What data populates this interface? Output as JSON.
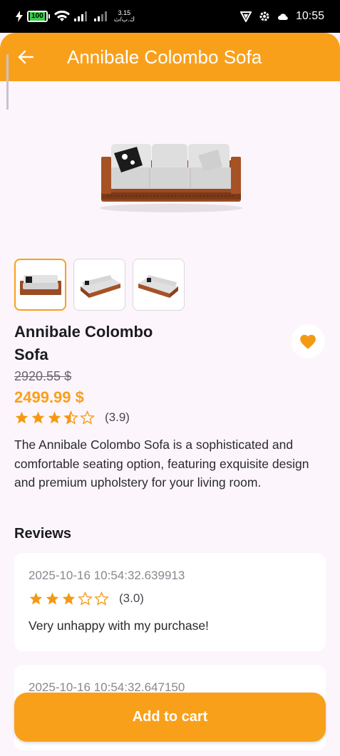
{
  "status_bar": {
    "battery": "100",
    "net_speed_top": "3.15",
    "net_speed_bottom": "ك.ب/ث",
    "time": "10:55"
  },
  "app_bar": {
    "title": "Annibale Colombo Sofa",
    "back_icon": "arrow-left-icon"
  },
  "product": {
    "name": "Annibale Colombo Sofa",
    "old_price": "2920.55 $",
    "price": "2499.99 $",
    "rating": 3.9,
    "rating_label": "(3.9)",
    "description": "The Annibale Colombo Sofa is a sophisticated and comfortable seating option, featuring exquisite design and premium upholstery for your living room.",
    "favorite": true,
    "thumbnails_count": 3,
    "selected_thumbnail": 1
  },
  "reviews": {
    "title": "Reviews",
    "items": [
      {
        "date": "2025-10-16 10:54:32.639913",
        "rating": 3.0,
        "rating_label": "(3.0)",
        "text": "Very unhappy with my purchase!"
      },
      {
        "date": "2025-10-16 10:54:32.647150"
      }
    ]
  },
  "cart": {
    "label": "Add to cart"
  },
  "colors": {
    "accent": "#f9a01b",
    "background": "#fcf5fc",
    "star": "#f39a12"
  }
}
